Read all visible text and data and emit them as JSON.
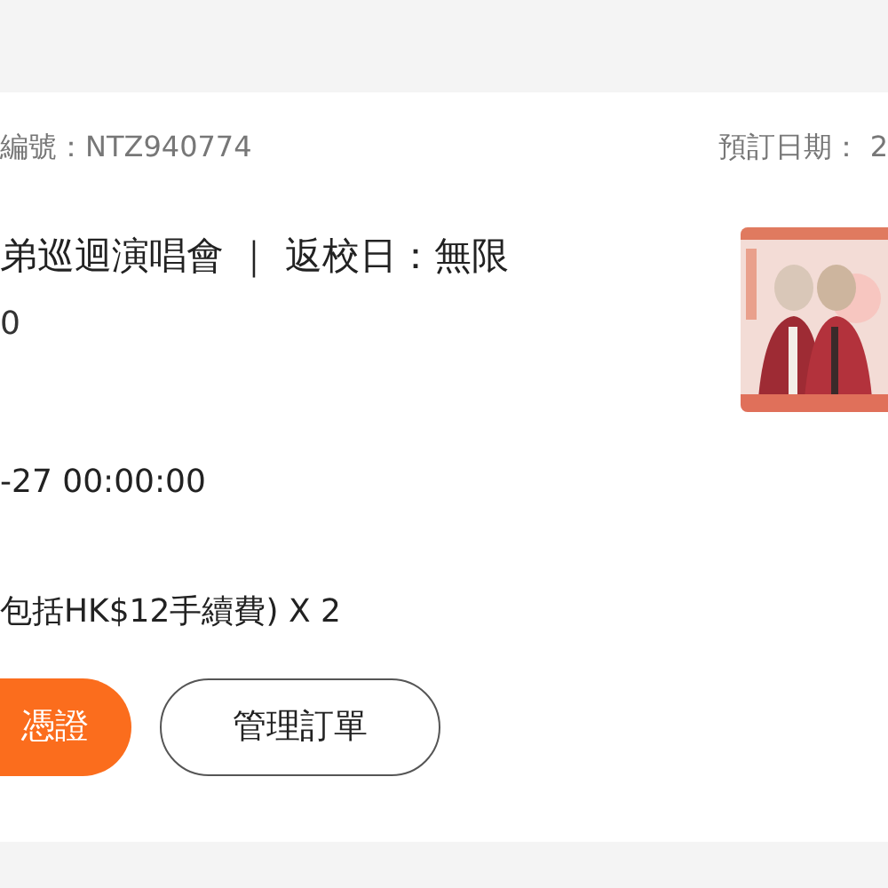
{
  "order": {
    "number": "編號：NTZ940774",
    "booking_date": "預訂日期： 2"
  },
  "event": {
    "title": "弟巡迴演唱會 ｜ 返校日：無限",
    "line_2": "0",
    "datetime": "-27 00:00:00",
    "price": "包括HK$12手續費) X 2"
  },
  "buttons": [
    {
      "label": "憑證",
      "kind": "primary"
    },
    {
      "label": "管理訂單",
      "kind": "outline"
    }
  ]
}
